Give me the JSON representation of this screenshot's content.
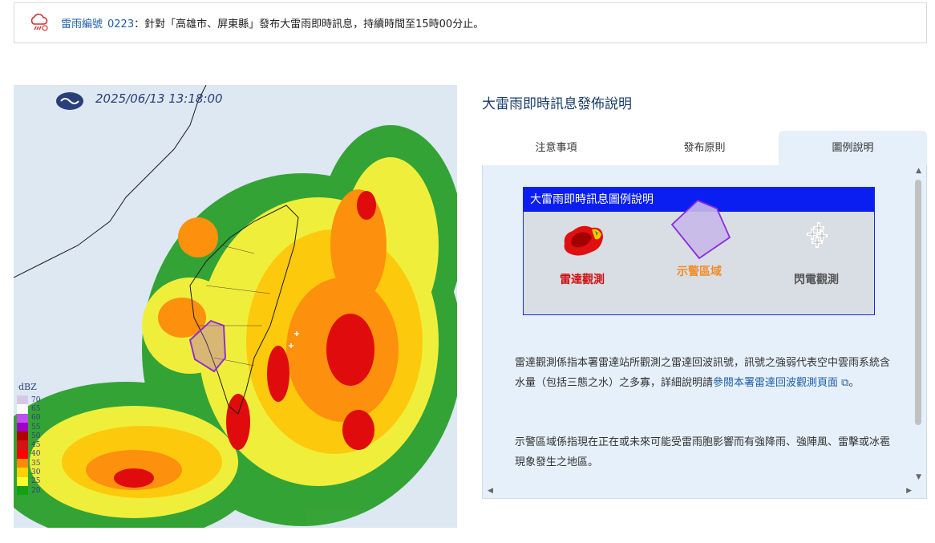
{
  "alert": {
    "link_label": "雷雨編號",
    "number": "0223",
    "message": "：針對「高雄市、屏東縣」發布大雷雨即時訊息，持續時間至15時00分止。",
    "icon": "thunderstorm-icon"
  },
  "radar": {
    "timestamp": "2025/06/13 13:18:00",
    "logo": "cwa-logo",
    "dbz_title": "dBZ",
    "dbz_labels": [
      "70",
      "65",
      "60",
      "55",
      "50",
      "45",
      "40",
      "35",
      "30",
      "25",
      "20"
    ],
    "dbz_colors": [
      "#d8c8e8",
      "#ffffff",
      "#c050f0",
      "#a000c8",
      "#b00000",
      "#d21414",
      "#ff0000",
      "#ff8c00",
      "#ffd200",
      "#ffff32",
      "#14a014"
    ]
  },
  "panel": {
    "title": "大雷雨即時訊息發佈說明",
    "tabs": [
      "注意事項",
      "發布原則",
      "圖例說明"
    ],
    "active_tab": "圖例說明",
    "legend": {
      "title": "大雷雨即時訊息圖例說明",
      "items": [
        {
          "label": "雷達觀測",
          "color": "#d01010"
        },
        {
          "label": "示警區域",
          "color": "#f08c28"
        },
        {
          "label": "閃電觀測",
          "color": "#555555"
        }
      ]
    },
    "para1_text": "雷達觀測係指本署雷達站所觀測之雷達回波訊號，訊號之強弱代表空中雲雨系統含水量（包括三態之水）之多寡，詳細說明請",
    "para1_link": "參閱本署雷達回波觀測頁面",
    "para1_end": "。",
    "para2_text": "示警區域係指現在正在或未來可能受雷雨胞影響而有強降雨、強陣風、雷擊或冰雹現象發生之地區。"
  }
}
